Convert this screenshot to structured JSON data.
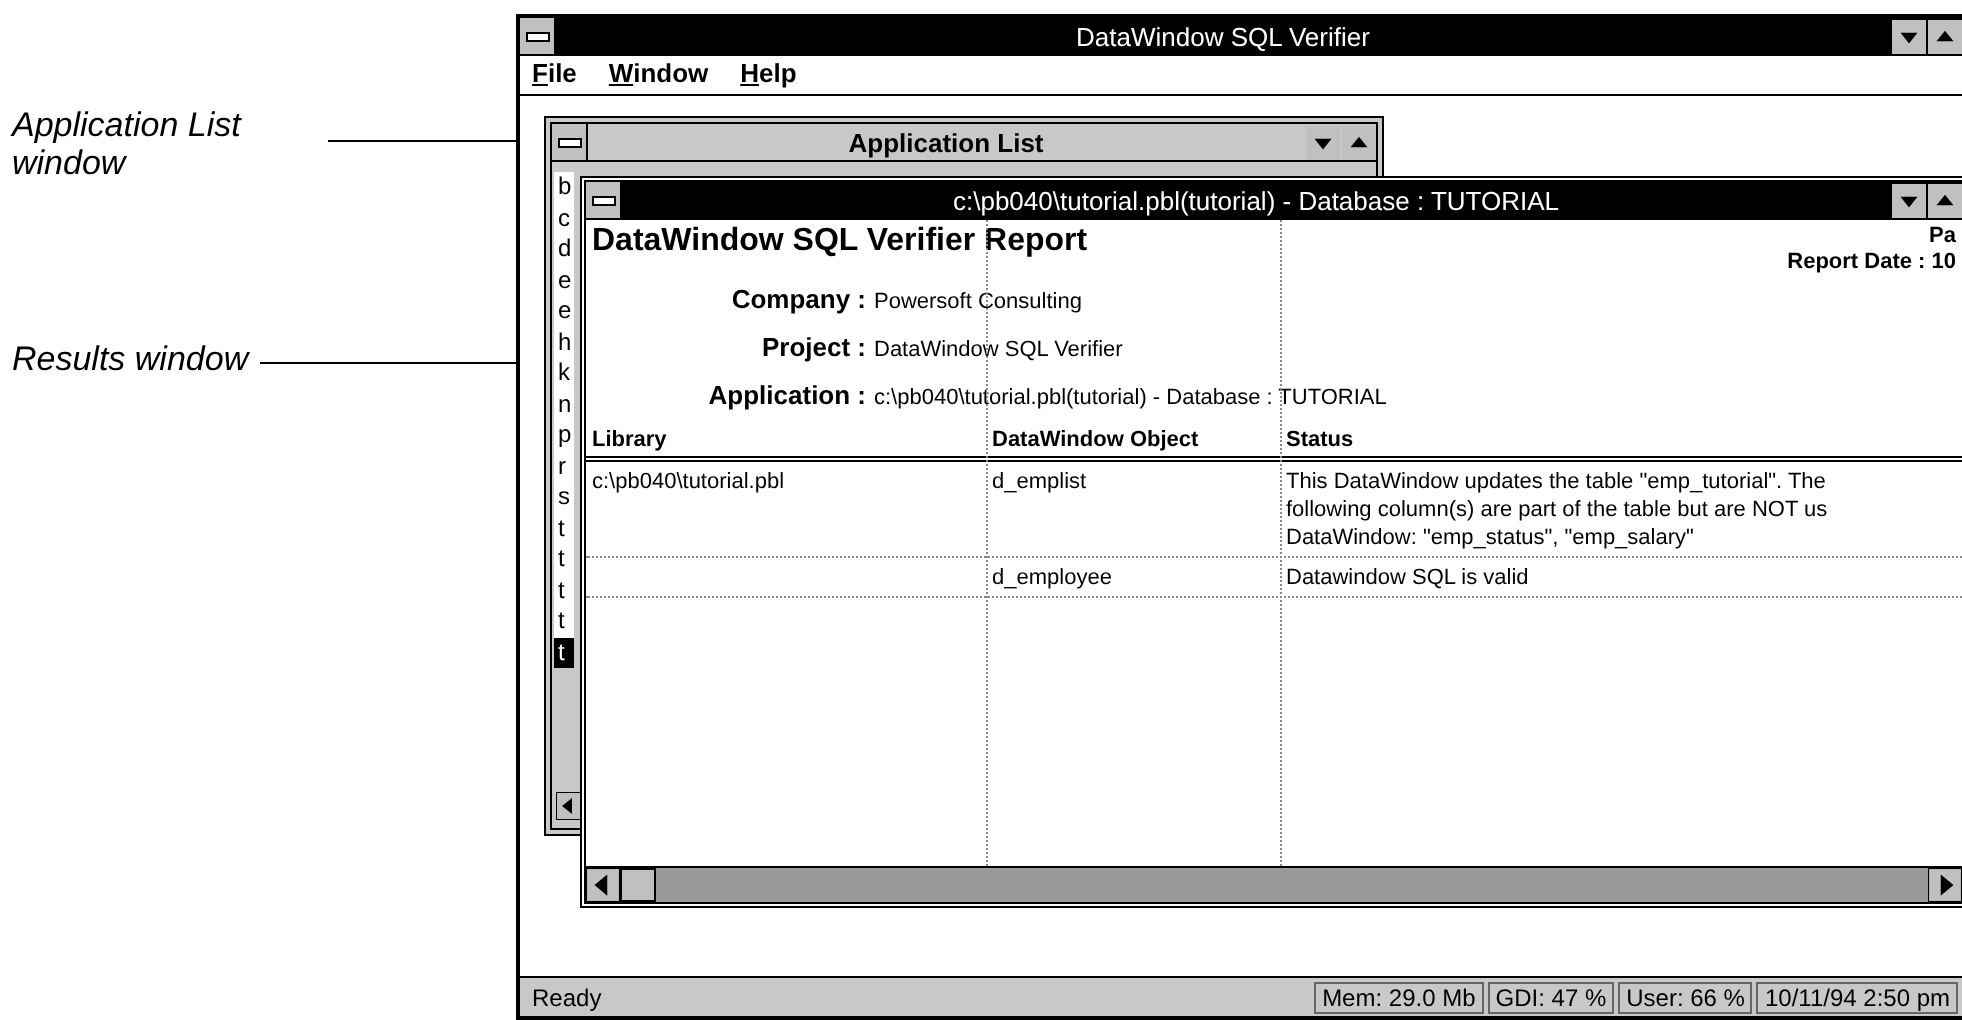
{
  "callouts": [
    {
      "text": "Application List\nwindow"
    },
    {
      "text": "Results window"
    }
  ],
  "app": {
    "title": "DataWindow SQL Verifier",
    "menu": [
      "File",
      "Window",
      "Help"
    ],
    "application_list": {
      "title": "Application List",
      "items": [
        {
          "label": "b",
          "selected": false
        },
        {
          "label": "c",
          "selected": false
        },
        {
          "label": "d",
          "selected": false
        },
        {
          "label": "e",
          "selected": false
        },
        {
          "label": "e",
          "selected": false
        },
        {
          "label": "h",
          "selected": false
        },
        {
          "label": "k",
          "selected": false
        },
        {
          "label": "n",
          "selected": false
        },
        {
          "label": "p",
          "selected": false
        },
        {
          "label": "r",
          "selected": false
        },
        {
          "label": "s",
          "selected": false
        },
        {
          "label": "t",
          "selected": false
        },
        {
          "label": "t",
          "selected": false
        },
        {
          "label": "t",
          "selected": false
        },
        {
          "label": "t",
          "selected": false
        },
        {
          "label": "t",
          "selected": true
        }
      ]
    },
    "results": {
      "title": "c:\\pb040\\tutorial.pbl(tutorial) - Database : TUTORIAL",
      "report_title": "DataWindow SQL Verifier Report",
      "page": "Pa",
      "report_date": "Report Date : 10",
      "fields": [
        {
          "label": "Company :",
          "value": "Powersoft Consulting"
        },
        {
          "label": "Project :",
          "value": "DataWindow SQL Verifier"
        },
        {
          "label": "Application :",
          "value": "c:\\pb040\\tutorial.pbl(tutorial) - Database : TUTORIAL"
        }
      ],
      "columns": [
        "Library",
        "DataWindow Object",
        "Status"
      ],
      "rows": [
        [
          "c:\\pb040\\tutorial.pbl",
          "d_emplist",
          "This DataWindow updates the table \"emp_tutorial\". The\nfollowing column(s) are part of the table but are NOT us\nDataWindow: \"emp_status\", \"emp_salary\""
        ],
        [
          null,
          "d_employee",
          "Datawindow SQL is valid"
        ]
      ]
    },
    "status_bar": [
      "Ready",
      "Mem: 29.0 Mb",
      "GDI: 47 %",
      "User: 66 %",
      "10/11/94 2:50 pm"
    ]
  }
}
